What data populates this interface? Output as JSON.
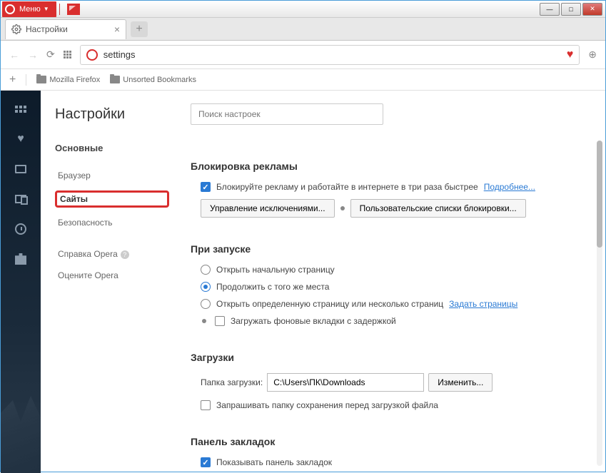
{
  "titlebar": {
    "menu_label": "Меню"
  },
  "tab": {
    "title": "Настройки"
  },
  "address": {
    "value": "settings"
  },
  "bookmarkbar": {
    "items": [
      "Mozilla Firefox",
      "Unsorted Bookmarks"
    ]
  },
  "sidebar": {
    "page_title": "Настройки",
    "basic_label": "Основные",
    "items": {
      "browser": "Браузер",
      "sites": "Сайты",
      "security": "Безопасность"
    },
    "help": "Справка Opera",
    "rate": "Оцените Opera"
  },
  "search": {
    "placeholder": "Поиск настроек"
  },
  "adblock": {
    "title": "Блокировка рекламы",
    "checkbox_label": "Блокируйте рекламу и работайте в интернете в три раза быстрее",
    "learn_more": "Подробнее...",
    "manage_btn": "Управление исключениями...",
    "lists_btn": "Пользовательские списки блокировки..."
  },
  "startup": {
    "title": "При запуске",
    "open_start": "Открыть начальную страницу",
    "continue": "Продолжить с того же места",
    "open_specific": "Открыть определенную страницу или несколько страниц",
    "set_pages": "Задать страницы",
    "lazy_load": "Загружать фоновые вкладки с задержкой"
  },
  "downloads": {
    "title": "Загрузки",
    "folder_label": "Папка загрузки:",
    "folder_value": "C:\\Users\\ПК\\Downloads",
    "change_btn": "Изменить...",
    "ask_label": "Запрашивать папку сохранения перед загрузкой файла"
  },
  "bookmarks_panel": {
    "title": "Панель закладок",
    "show_label": "Показывать панель закладок"
  }
}
